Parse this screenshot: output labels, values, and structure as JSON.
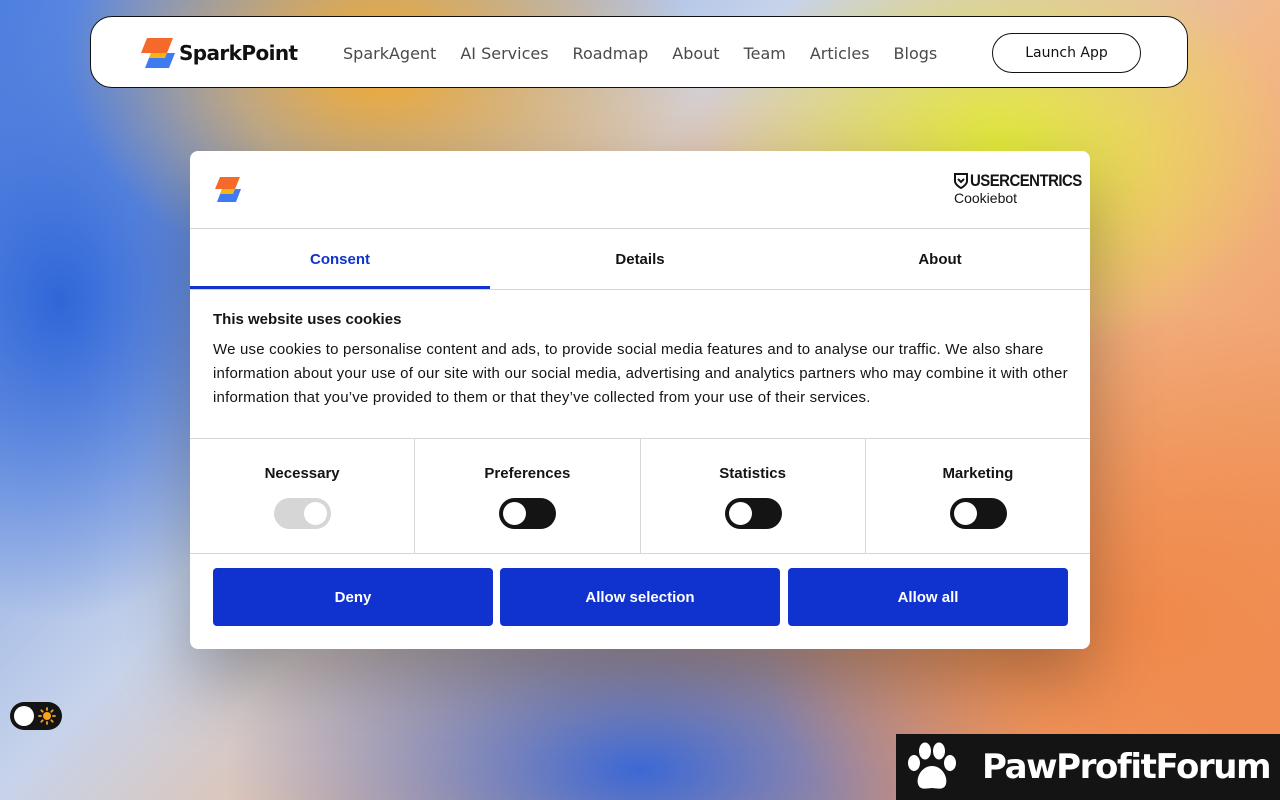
{
  "header": {
    "brand_name": "SparkPoint",
    "nav": [
      "SparkAgent",
      "AI Services",
      "Roadmap",
      "About",
      "Team",
      "Articles",
      "Blogs"
    ],
    "launch_label": "Launch App"
  },
  "cookie_dialog": {
    "provider_name": "USERCENTRICS",
    "provider_product": "Cookiebot",
    "tabs": [
      {
        "label": "Consent",
        "active": true
      },
      {
        "label": "Details",
        "active": false
      },
      {
        "label": "About",
        "active": false
      }
    ],
    "title": "This website uses cookies",
    "body": "We use cookies to personalise content and ads, to provide social media features and to analyse our traffic. We also share information about your use of our site with our social media, advertising and analytics partners who may combine it with other information that you’ve provided to them or that they’ve collected from your use of their services.",
    "categories": [
      {
        "label": "Necessary",
        "enabled": true,
        "locked": true
      },
      {
        "label": "Preferences",
        "enabled": false,
        "locked": false
      },
      {
        "label": "Statistics",
        "enabled": false,
        "locked": false
      },
      {
        "label": "Marketing",
        "enabled": false,
        "locked": false
      }
    ],
    "buttons": {
      "deny": "Deny",
      "allow_selection": "Allow selection",
      "allow_all": "Allow all"
    },
    "accent_color": "#1032cf"
  },
  "theme_toggle": {
    "mode": "light",
    "icon": "sun-icon"
  },
  "watermark": {
    "text": "PawProfitForum",
    "icon": "paw-icon"
  },
  "colors": {
    "brand_orange": "#f56a2a",
    "brand_blue": "#3f7bf0",
    "text_dark": "#141414"
  }
}
